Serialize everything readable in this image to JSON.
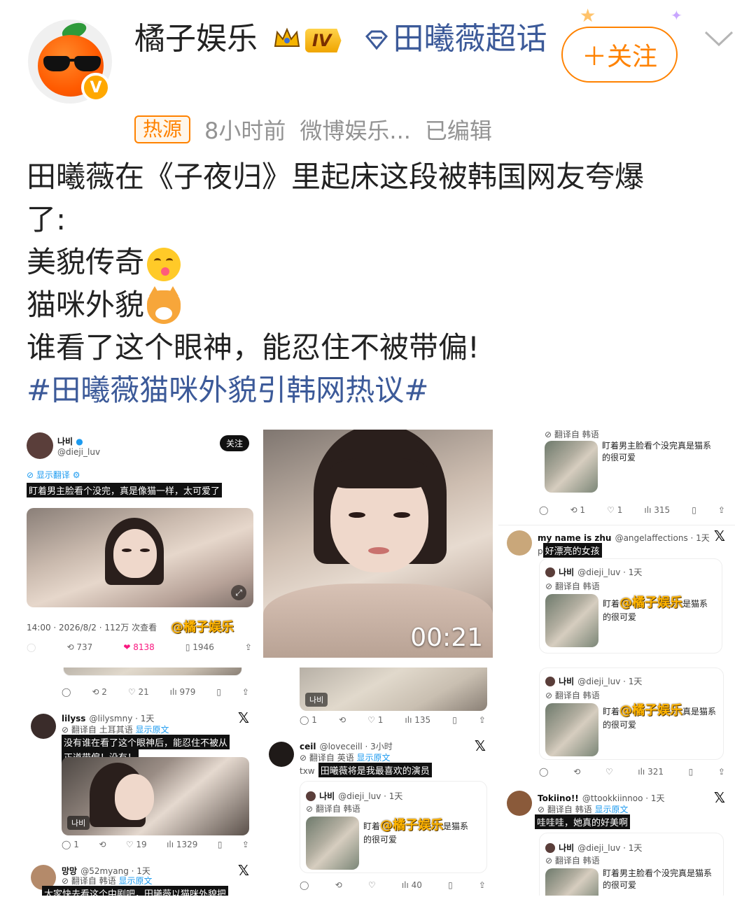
{
  "post": {
    "username": "橘子娱乐",
    "level_badge": "IV",
    "topic": "田曦薇超话",
    "follow_label": "＋关注",
    "hot_tag": "热源",
    "time": "8小时前",
    "source": "微博娱乐...",
    "edited": "已编辑",
    "verified_badge": "V",
    "body_line1": "田曦薇在《子夜归》里起床这段被韩国网友夸爆",
    "body_line2": "了:",
    "body_line3": "美貌传奇",
    "body_line4": "猫咪外貌",
    "body_line5": "谁看了这个眼神，能忍住不被带偏!",
    "hashtag": "#田曦薇猫咪外貌引韩网热议#"
  },
  "colors": {
    "accent": "#ff8200",
    "link": "#3c5a99",
    "meta": "#939393",
    "level": "#f0a500"
  },
  "images": {
    "c1": {
      "name": "나비",
      "handle": "@dieji_luv",
      "follow": "关注",
      "translate": "显示翻译",
      "caption": "盯着男主脸看个没完，真是像猫一样，太可爱了",
      "timestamp": "14:00 · 2026/8/2 · 112万 次查看",
      "watermark": "@橘子娱乐",
      "retweets": "737",
      "likes": "8138",
      "bookmarks": "1946"
    },
    "c2": {
      "duration": "00:21"
    },
    "c3": {
      "translated_from": "翻译自 韩语",
      "quote_text1": "盯着男主脸看个没完真是猫系",
      "quote_text2": "的很可爱",
      "rt": "1",
      "like": "1",
      "views": "315",
      "reply_name": "my name is zhu",
      "reply_handle": "@angelaffections · 1天",
      "reply_prefix": "p",
      "reply_text": "好漂亮的女孩",
      "q_name": "나비",
      "q_handle": "@dieji_luv · 1天",
      "q_lang": "翻译自 韩语",
      "q_text1a": "盯着",
      "q_text1b": "是猫系",
      "q_text2": "的很可爱",
      "watermark": "@橘子娱乐"
    },
    "c4": {
      "rt": "2",
      "like": "21",
      "views": "979",
      "name": "lilyss",
      "handle": "@lilysmny · 1天",
      "lang": "翻译自 土耳其语",
      "show_original": "显示原文",
      "caption1": "没有谁在看了这个眼神后，能忍住不被从",
      "caption2": "正道带偏！没有！",
      "tag": "나비",
      "reply": "1",
      "like2": "19",
      "views2": "1329",
      "next_name": "망망",
      "next_handle": "@52myang · 1天",
      "next_lang": "翻译自 韩语",
      "next_show": "显示原文",
      "next_caption": "大家快去看这个中剧吧，田曦薇以猫咪外貌把"
    },
    "c5": {
      "tag": "나비",
      "reply": "1",
      "like": "1",
      "views": "135",
      "name": "ceil",
      "handle": "@loveceill · 3小时",
      "lang": "翻译自 英语",
      "show_original": "显示原文",
      "prefix": "txw",
      "caption": "田曦薇将是我最喜欢的演员",
      "q_name": "나비",
      "q_handle": "@dieji_luv · 1天",
      "q_lang": "翻译自 韩语",
      "q_text1a": "盯着",
      "q_text1b": "是猫系",
      "q_text2": "的很可爱",
      "watermark": "@橘子娱乐",
      "views2": "40"
    },
    "c6": {
      "q_name": "나비",
      "q_handle": "@dieji_luv · 1天",
      "q_lang": "翻译自 韩语",
      "q_text1a": "盯着",
      "q_text1b": "真是猫系",
      "q_text2": "的很可爱",
      "watermark": "@橘子娱乐",
      "views": "321",
      "name": "Tokiino!!",
      "handle": "@ttookkiinnoo · 1天",
      "lang": "翻译自 韩语",
      "show_original": "显示原文",
      "caption": "哇哇哇，她真的好美啊",
      "q2_name": "나비",
      "q2_handle": "@dieji_luv · 1天",
      "q2_lang": "翻译自 韩语",
      "q2_text1": "盯着男主脸看个没完真是猫系",
      "q2_text2": "的很可爱"
    }
  }
}
